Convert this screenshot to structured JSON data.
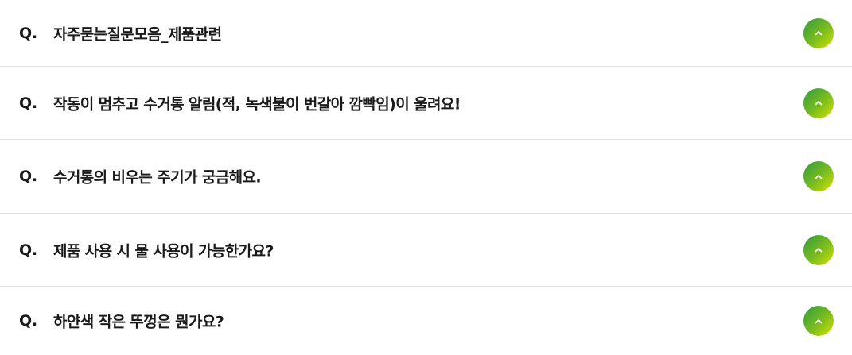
{
  "faq": {
    "prefix": "Q.",
    "items": [
      {
        "question": "자주묻는질문모음_제품관련",
        "toggle_icon": "chevron-up-icon"
      },
      {
        "question": "작동이 멈추고 수거통 알림(적, 녹색불이 번갈아 깜빡임)이 울려요!",
        "toggle_icon": "chevron-up-icon"
      },
      {
        "question": "수거통의 비우는 주기가 궁금해요.",
        "toggle_icon": "chevron-up-icon"
      },
      {
        "question": "제품 사용 시 물 사용이 가능한가요?",
        "toggle_icon": "chevron-up-icon"
      },
      {
        "question": "하얀색 작은 뚜껑은 뭔가요?",
        "toggle_icon": "chevron-up-icon"
      }
    ]
  },
  "colors": {
    "text": "#1a1a1a",
    "divider": "#e0e0e0",
    "button_gradient_start": "#2f9a3e",
    "button_gradient_end": "#d6e400",
    "icon": "#ffffff"
  }
}
